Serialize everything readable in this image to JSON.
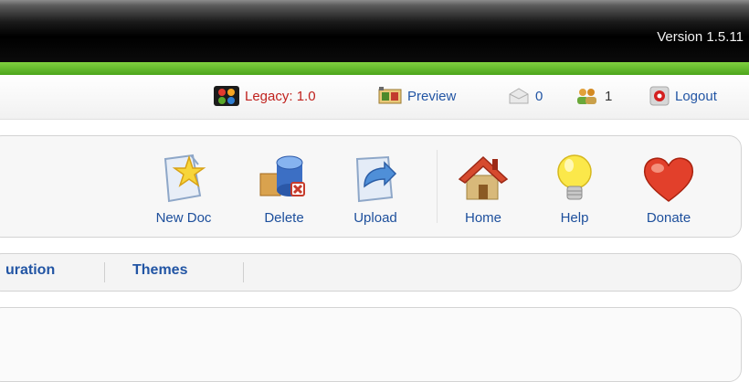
{
  "header": {
    "version": "Version 1.5.11"
  },
  "status": {
    "legacy": "Legacy: 1.0",
    "preview": "Preview",
    "messages": "0",
    "users": "1",
    "logout": "Logout"
  },
  "toolbar": {
    "new_doc": "New Doc",
    "delete": "Delete",
    "upload": "Upload",
    "home": "Home",
    "help": "Help",
    "donate": "Donate"
  },
  "tabs": [
    "uration",
    "Themes"
  ],
  "colors": {
    "accent_green": "#5db52a",
    "link_blue": "#2255a4",
    "legacy_red": "#c0221e"
  }
}
